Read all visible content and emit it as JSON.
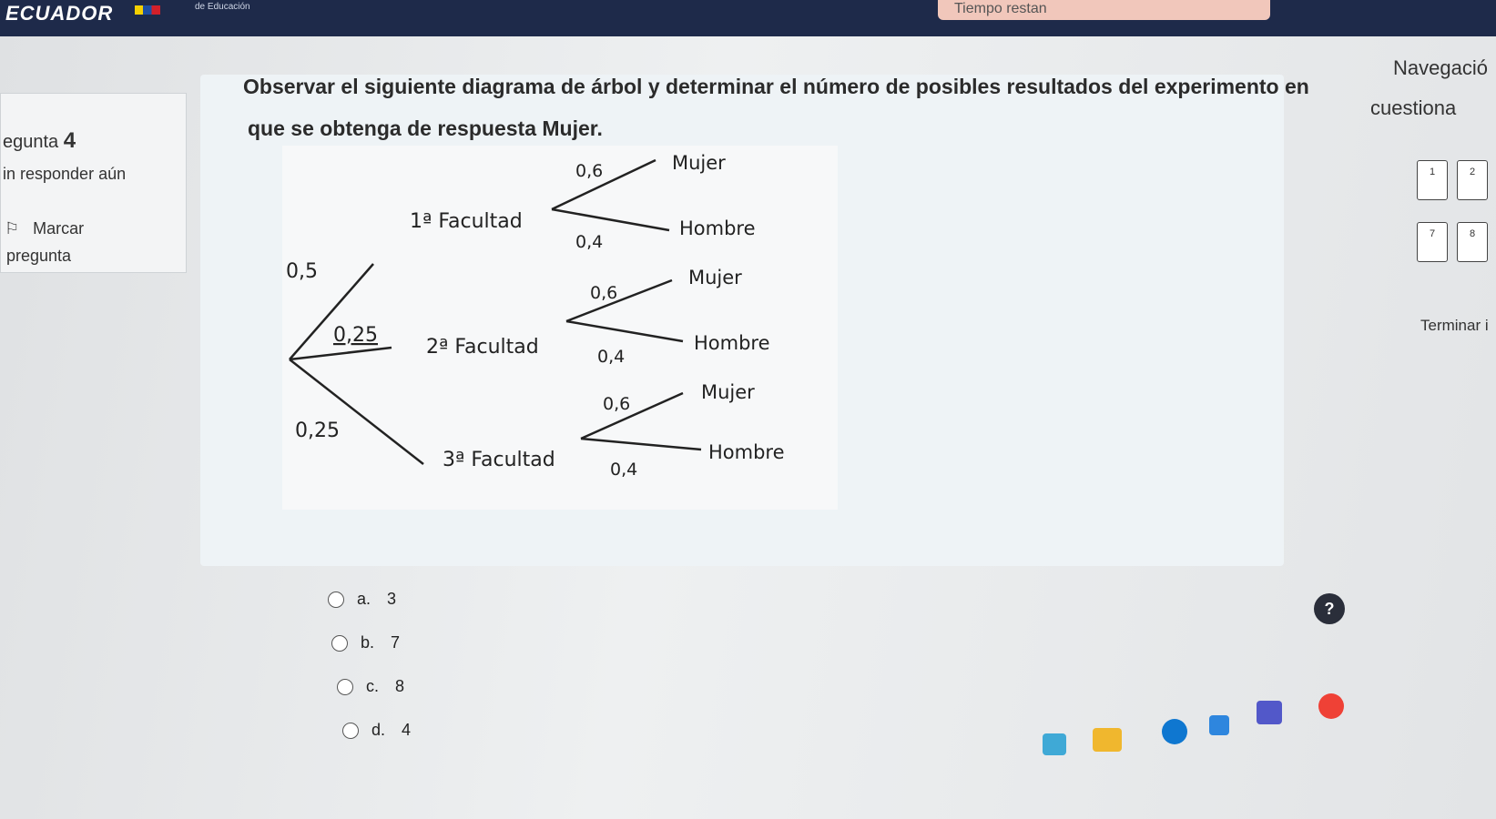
{
  "header": {
    "brand": "ECUADOR",
    "brand_sub": "de Educación",
    "timer_label": "Tiempo restan"
  },
  "question_info": {
    "label": "egunta",
    "number": "4",
    "status": "in responder aún",
    "flag_label_1": "Marcar",
    "flag_label_2": "pregunta"
  },
  "question": {
    "text_line_1": "Observar el siguiente diagrama de árbol y determinar el número de posibles resultados del experimento en",
    "text_line_2": "que se obtenga de respuesta Mujer."
  },
  "diagram": {
    "level1": [
      {
        "name": "1ª Facultad",
        "prob": "0,5"
      },
      {
        "name": "2ª Facultad",
        "prob": "0,25"
      },
      {
        "name": "3ª Facultad",
        "prob": "0,25"
      }
    ],
    "level2": [
      {
        "name": "Mujer",
        "prob": "0,6"
      },
      {
        "name": "Hombre",
        "prob": "0,4"
      }
    ]
  },
  "answers": [
    {
      "letter": "a.",
      "text": "3"
    },
    {
      "letter": "b.",
      "text": "7"
    },
    {
      "letter": "c.",
      "text": "8"
    },
    {
      "letter": "d.",
      "text": "4"
    }
  ],
  "navigation": {
    "title": "Navegació",
    "subtitle": "cuestiona",
    "buttons": [
      "1",
      "2",
      "7",
      "8"
    ],
    "finish": "Terminar i"
  },
  "help": "?"
}
